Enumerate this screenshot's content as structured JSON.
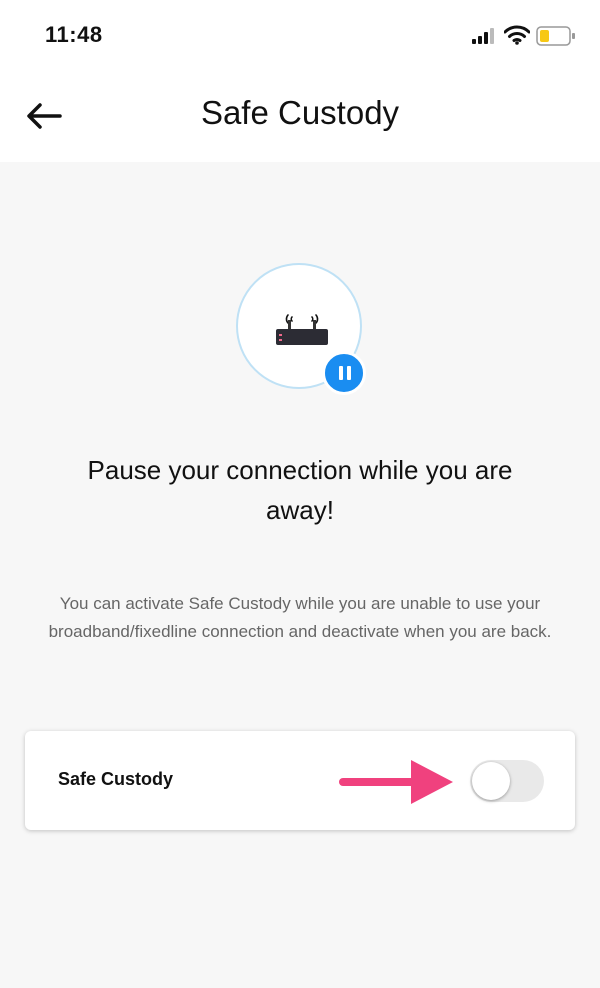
{
  "status_bar": {
    "time": "11:48"
  },
  "header": {
    "title": "Safe Custody"
  },
  "hero": {
    "headline": "Pause your connection while you are away!",
    "description": "You can activate Safe Custody while you are unable to use your broadband/fixedline connection and deactivate when you are back."
  },
  "card": {
    "label": "Safe Custody",
    "toggle_on": false
  },
  "colors": {
    "accent": "#1a8df1",
    "arrow": "#f0417e",
    "hero_ring": "#bfe1f5",
    "battery_fill": "#f7c815"
  },
  "icons": {
    "back": "arrow-left-icon",
    "router": "router-icon",
    "pause": "pause-icon",
    "signal": "signal-icon",
    "wifi": "wifi-icon",
    "battery": "battery-icon",
    "pointer": "arrow-right-icon"
  }
}
